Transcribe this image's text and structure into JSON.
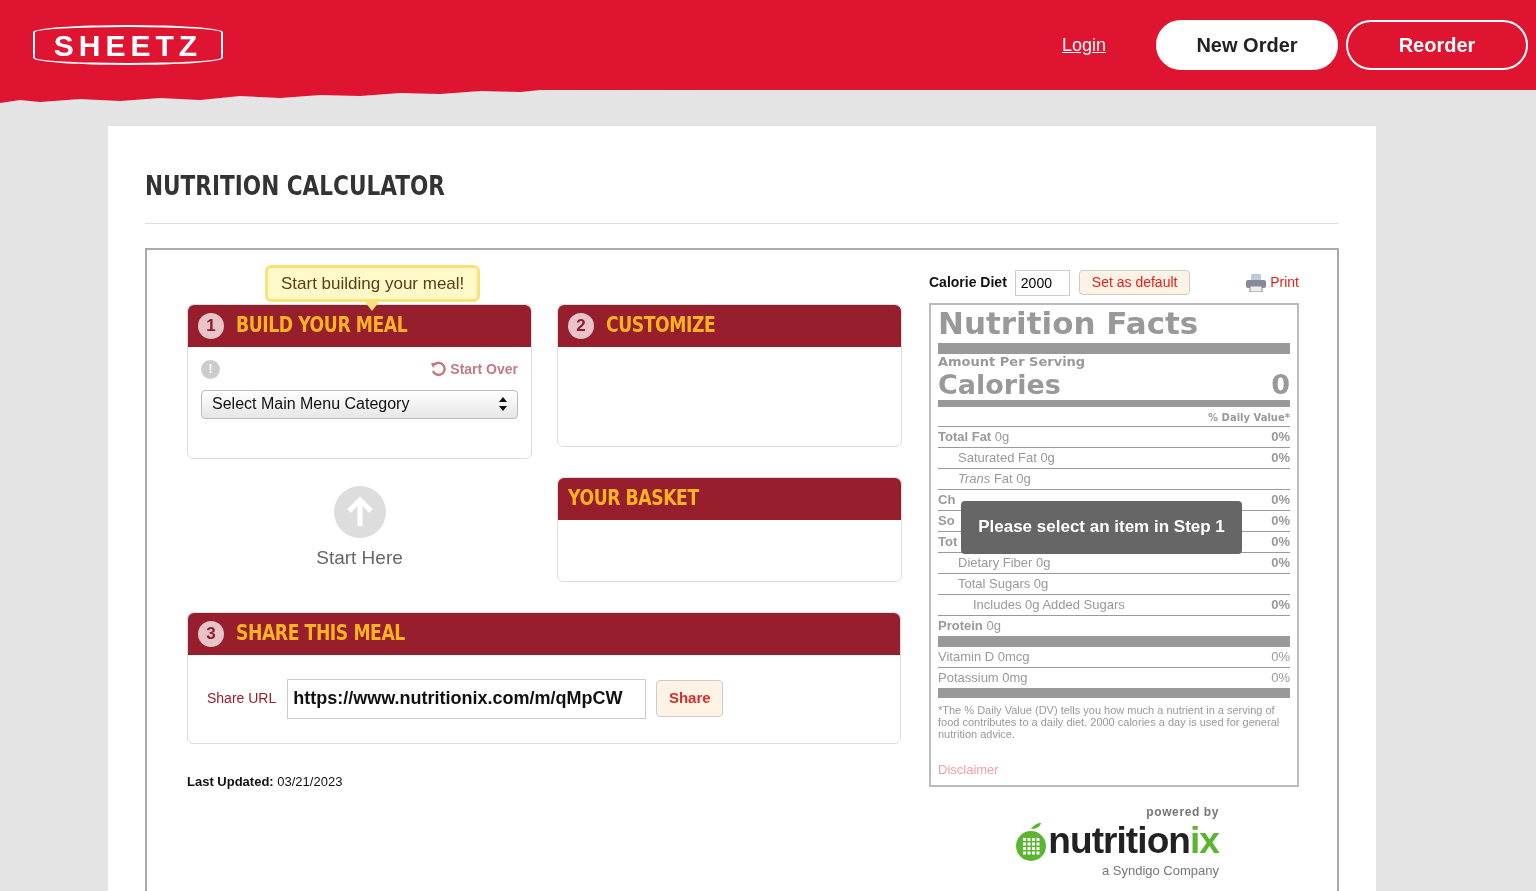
{
  "header": {
    "logo": "SHEETZ",
    "login": "Login",
    "buttons": [
      {
        "label": "New Order",
        "kind": "filled"
      },
      {
        "label": "Reorder",
        "kind": "outline"
      }
    ]
  },
  "title": "NUTRITION CALCULATOR",
  "bubble": "Start building your meal!",
  "build": {
    "number": "1",
    "info": "!",
    "title": "BUILD YOUR MEAL",
    "start_over": "Start Over",
    "select": "Select Main Menu Category"
  },
  "customize": {
    "number": "2",
    "title": "CUSTOMIZE"
  },
  "basket": {
    "title": "YOUR BASKET"
  },
  "start_here": "Start Here",
  "share": {
    "number": "3",
    "title": "SHARE THIS MEAL",
    "label": "Share URL",
    "url": "https://www.nutritionix.com/m/qMpCW",
    "button": "Share"
  },
  "last_updated": {
    "label": "Last Updated:",
    "date": "03/21/2023"
  },
  "calorie_diet": {
    "label": "Calorie Diet",
    "value": "2000",
    "default_button": "Set as default",
    "print": "Print"
  },
  "facts": {
    "title": "Nutrition Facts",
    "amount_per_serving": "Amount Per Serving",
    "calories_label": "Calories",
    "calories": "0",
    "daily_value": "% Daily Value*",
    "nutrients": [
      {
        "kind": "main",
        "label": "Total Fat",
        "amount": "0g",
        "dv": "0%"
      },
      {
        "kind": "sub",
        "label": "Saturated Fat 0g",
        "dv": "0%"
      },
      {
        "kind": "sub",
        "label": "*Trans* Fat 0g"
      },
      {
        "kind": "main",
        "label": "Ch",
        "dv": "0%"
      },
      {
        "kind": "main",
        "label": "So",
        "dv": "0%"
      },
      {
        "kind": "main",
        "label": "Tot",
        "dv": "0%"
      },
      {
        "kind": "sub",
        "label": "Dietary Fiber 0g",
        "dv": "0%"
      },
      {
        "kind": "sub",
        "label": "Total Sugars 0g"
      },
      {
        "kind": "subsub",
        "label": "Includes 0g Added Sugars",
        "dv": "0%"
      },
      {
        "kind": "main",
        "label": "Protein",
        "amount": "0g"
      }
    ],
    "vitamins": [
      {
        "label": "Vitamin D 0mcg",
        "dv": "0%"
      },
      {
        "label": "Potassium 0mg",
        "dv": "0%"
      }
    ],
    "footnote": "*The % Daily Value (DV) tells you how much a nutrient in a serving of food contributes to a daily diet. 2000 calories a day is used for general nutrition advice.",
    "disclaimer": "Disclaimer"
  },
  "tooltip": "Please select an item in Step 1",
  "powered": {
    "by": "powered by",
    "brand_dark": "nutrition",
    "brand_green": "ix",
    "tagline": "a Syndigo Company"
  }
}
